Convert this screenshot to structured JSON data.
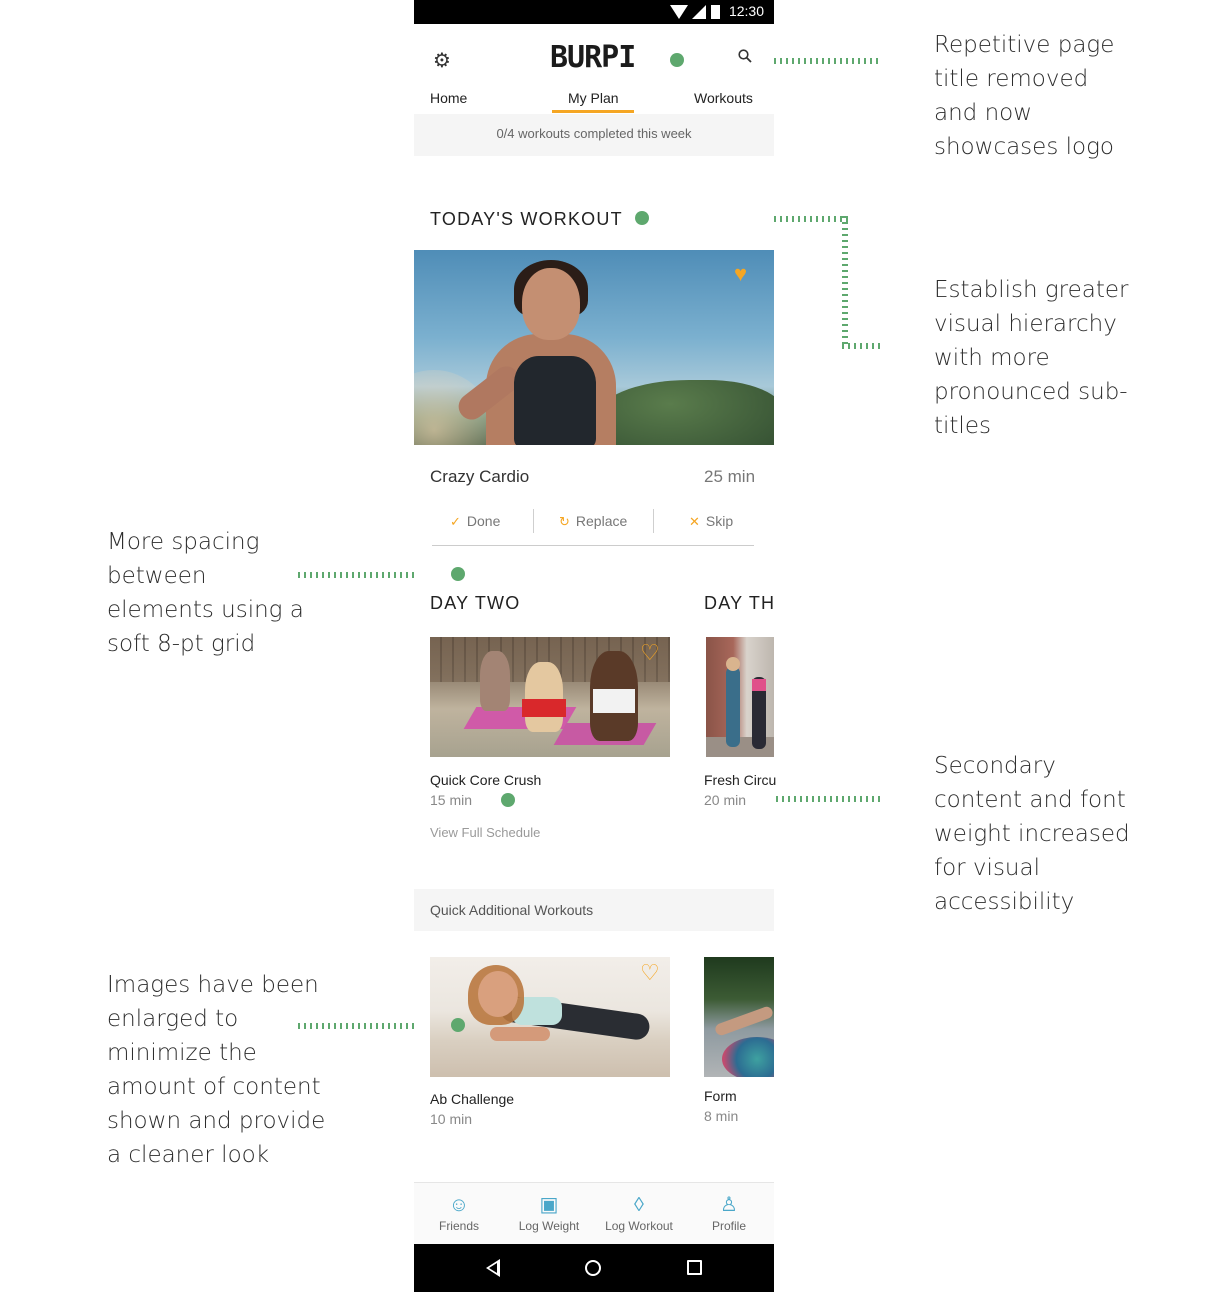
{
  "status_bar": {
    "time": "12:30"
  },
  "header": {
    "logo_text": "BURPI",
    "tabs": [
      {
        "label": "Home"
      },
      {
        "label": "My Plan",
        "active": true
      },
      {
        "label": "Workouts"
      }
    ],
    "progress_text": "0/4 workouts completed this week"
  },
  "today": {
    "section_title": "TODAY'S WORKOUT",
    "workout_name": "Crazy Cardio",
    "duration": "25 min",
    "actions": [
      {
        "label": "Done",
        "icon": "check-icon"
      },
      {
        "label": "Replace",
        "icon": "refresh-icon"
      },
      {
        "label": "Skip",
        "icon": "close-icon"
      }
    ]
  },
  "schedule": {
    "day_two_title": "DAY TWO",
    "day_three_title": "DAY TH",
    "cards": [
      {
        "title": "Quick Core Crush",
        "duration": "15 min"
      },
      {
        "title": "Fresh Circu",
        "duration": "20 min"
      }
    ],
    "view_link": "View Full Schedule"
  },
  "quick": {
    "title": "Quick Additional Workouts",
    "cards": [
      {
        "title": "Ab Challenge",
        "duration": "10 min"
      },
      {
        "title": "Form",
        "duration": "8 min"
      }
    ]
  },
  "bottom_nav": [
    {
      "label": "Friends",
      "icon": "friends-icon"
    },
    {
      "label": "Log Weight",
      "icon": "scale-icon"
    },
    {
      "label": "Log Workout",
      "icon": "droplet-icon"
    },
    {
      "label": "Profile",
      "icon": "profile-icon"
    }
  ],
  "annotations": {
    "logo_note": "Repetitive page title removed and now showcases logo",
    "hierarchy_note": "Establish greater visual hierarchy with more pronounced sub-titles",
    "spacing_note": "More spacing between elements using a soft 8-pt grid",
    "secondary_note": "Secondary content and font weight increased for visual accessibility",
    "images_note": "Images have been enlarged to minimize the amount of content shown and provide a cleaner look"
  },
  "colors": {
    "accent": "#f5a623",
    "annotation": "#5ea86e",
    "nav_icon": "#4aa7c9"
  }
}
